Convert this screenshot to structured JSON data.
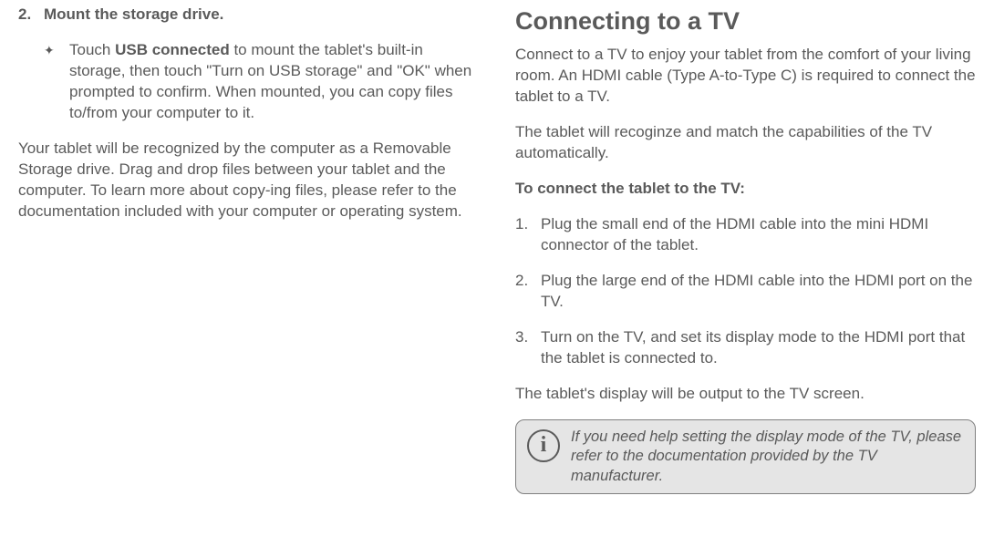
{
  "left": {
    "step2_number": "2.",
    "step2_title": "Mount the storage drive.",
    "bullet_symbol": "✦",
    "bullet_prefix": "Touch ",
    "bullet_bold": "USB connected",
    "bullet_rest": " to mount the tablet's  built-in storage, then touch \"Turn on USB storage\" and \"OK\" when prompted to confirm. When mounted, you can copy files to/from your computer to it.",
    "para1": "Your tablet will be recognized by the computer as a Removable Storage drive. Drag and drop files between your tablet and the computer. To learn more about copy-ing files, please refer to the documentation included with your computer or operating system."
  },
  "right": {
    "heading": "Connecting to a TV",
    "intro": "Connect to a TV to enjoy your tablet from the comfort of your living room. An HDMI cable (Type A-to-Type C) is required to connect the tablet to a TV.",
    "auto": "The tablet will recoginze and match the capabilities of the TV automatically.",
    "sub_bold": "To connect the tablet to the TV:",
    "steps": [
      {
        "n": "1.",
        "t": "Plug the small end of the HDMI cable into the mini HDMI connector of the tablet."
      },
      {
        "n": "2.",
        "t": "Plug the large end of the HDMI cable into the HDMI port on the TV."
      },
      {
        "n": "3.",
        "t": "Turn on the TV, and set its display mode to the HDMI port that the tablet is connected to."
      }
    ],
    "result": "The tablet's display will be output to the TV screen.",
    "info_icon": "i",
    "info_text": "If you need help setting the display mode of the TV, please refer to the documentation provided by the TV manufacturer."
  }
}
